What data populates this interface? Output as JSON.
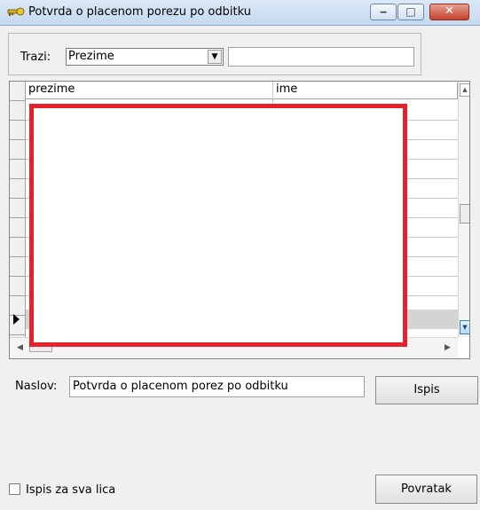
{
  "window": {
    "title": "Potvrda o placenom porezu po odbitku",
    "icon": "key-icon",
    "buttons": {
      "minimize": "minimize-icon",
      "maximize": "maximize-icon",
      "close": "close-icon"
    }
  },
  "search": {
    "label": "Trazi:",
    "field_select": "Prezime",
    "query": ""
  },
  "grid": {
    "columns": [
      "prezime",
      "ime"
    ],
    "rows": []
  },
  "naslov": {
    "label": "Naslov:",
    "value": "Potvrda o placenom porez po odbitku"
  },
  "buttons": {
    "print": "Ispis",
    "back": "Povratak"
  },
  "options": {
    "print_all_label": "Ispis za sva lica",
    "print_all_checked": false
  },
  "colors": {
    "redaction": "#e4222c"
  }
}
